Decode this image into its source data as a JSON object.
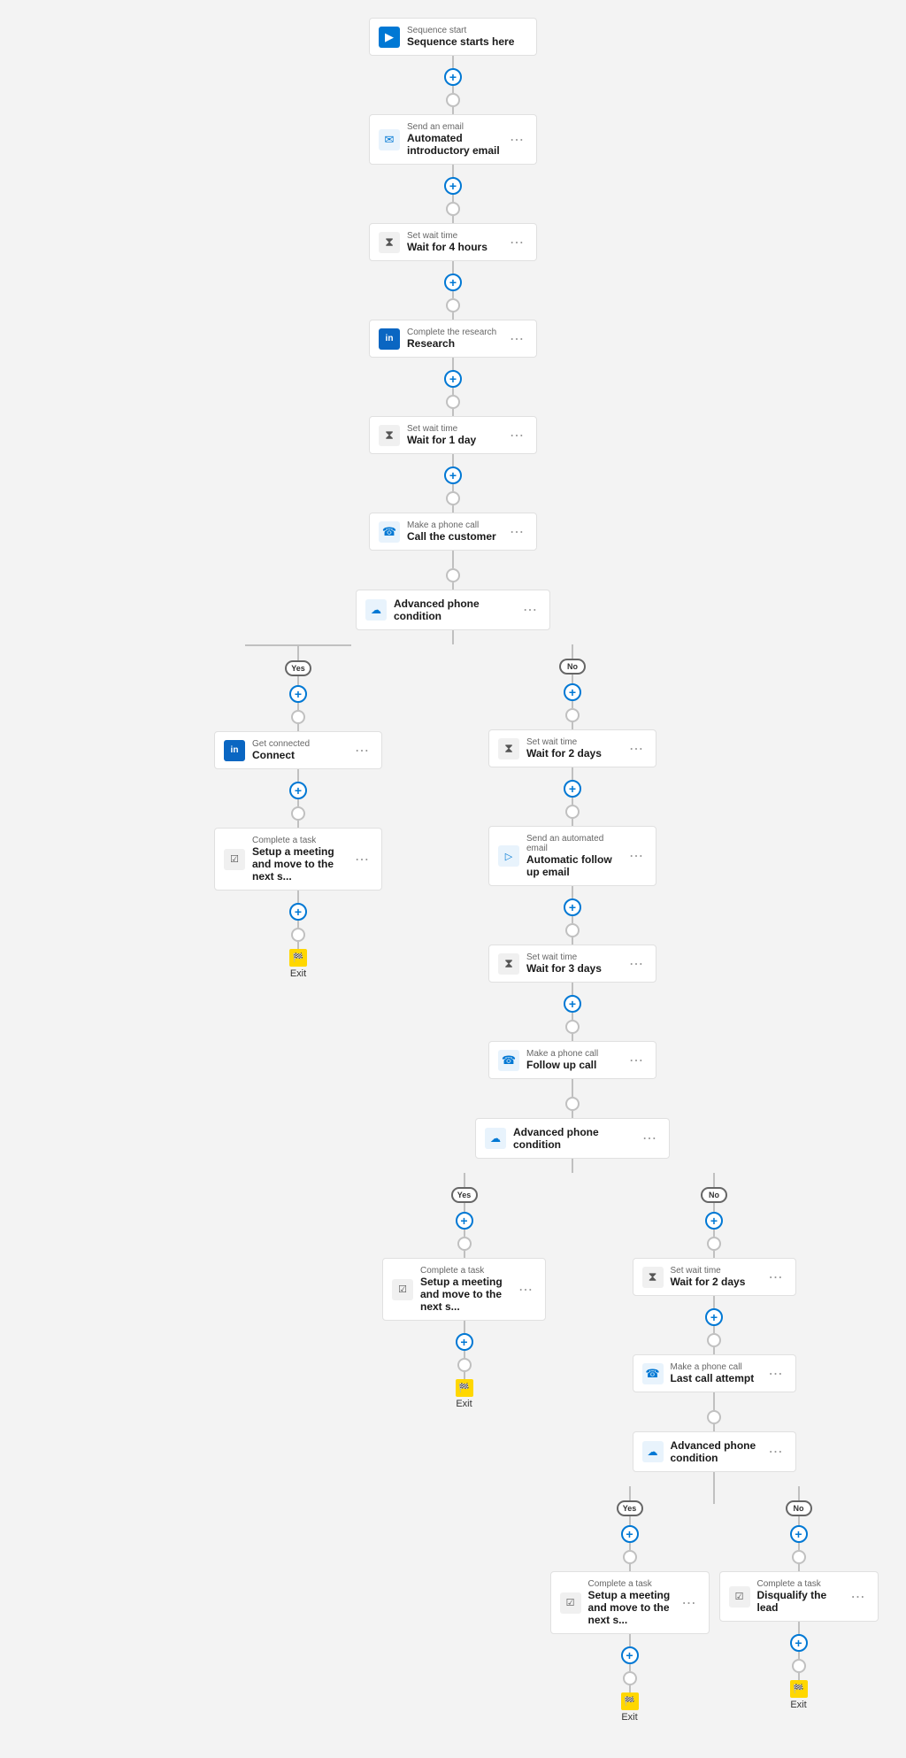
{
  "nodes": {
    "sequence_start": {
      "label": "Sequence start",
      "title": "Sequence starts here"
    },
    "send_email_1": {
      "label": "Send an email",
      "title": "Automated introductory email"
    },
    "wait_1": {
      "label": "Set wait time",
      "title": "Wait for 4 hours"
    },
    "research": {
      "label": "Complete the research",
      "title": "Research"
    },
    "wait_2": {
      "label": "Set wait time",
      "title": "Wait for 1 day"
    },
    "phone_call_1": {
      "label": "Make a phone call",
      "title": "Call the customer"
    },
    "condition_1": {
      "label": "Advanced phone condition"
    },
    "yes_label": "Yes",
    "no_label": "No",
    "connect": {
      "label": "Get connected",
      "title": "Connect"
    },
    "task_1": {
      "label": "Complete a task",
      "title": "Setup a meeting and move to the next s..."
    },
    "exit_1": "Exit",
    "wait_3": {
      "label": "Set wait time",
      "title": "Wait for 2 days"
    },
    "auto_email": {
      "label": "Send an automated email",
      "title": "Automatic follow up email"
    },
    "wait_4": {
      "label": "Set wait time",
      "title": "Wait for 3 days"
    },
    "phone_call_2": {
      "label": "Make a phone call",
      "title": "Follow up call"
    },
    "condition_2": {
      "label": "Advanced phone condition"
    },
    "task_2": {
      "label": "Complete a task",
      "title": "Setup a meeting and move to the next s..."
    },
    "exit_2": "Exit",
    "wait_5": {
      "label": "Set wait time",
      "title": "Wait for 2 days"
    },
    "phone_call_3": {
      "label": "Make a phone call",
      "title": "Last call attempt"
    },
    "condition_3": {
      "label": "Advanced phone condition"
    },
    "task_3": {
      "label": "Complete a task",
      "title": "Setup a meeting and move to the next s..."
    },
    "disqualify": {
      "label": "Complete a task",
      "title": "Disqualify the lead"
    },
    "exit_3": "Exit",
    "exit_4": "Exit"
  },
  "icons": {
    "sequence": "▶",
    "email": "✉",
    "wait": "⧖",
    "task_blue": "in",
    "phone": "☎",
    "condition": "☁",
    "task": "☑",
    "exit": "🏁",
    "more": "⋯"
  },
  "colors": {
    "accent": "#0078d4",
    "border": "#e0e0e0",
    "line": "#c0c0c0",
    "bg": "#f3f3f3",
    "white": "#ffffff",
    "exit_yellow": "#ffd700"
  }
}
